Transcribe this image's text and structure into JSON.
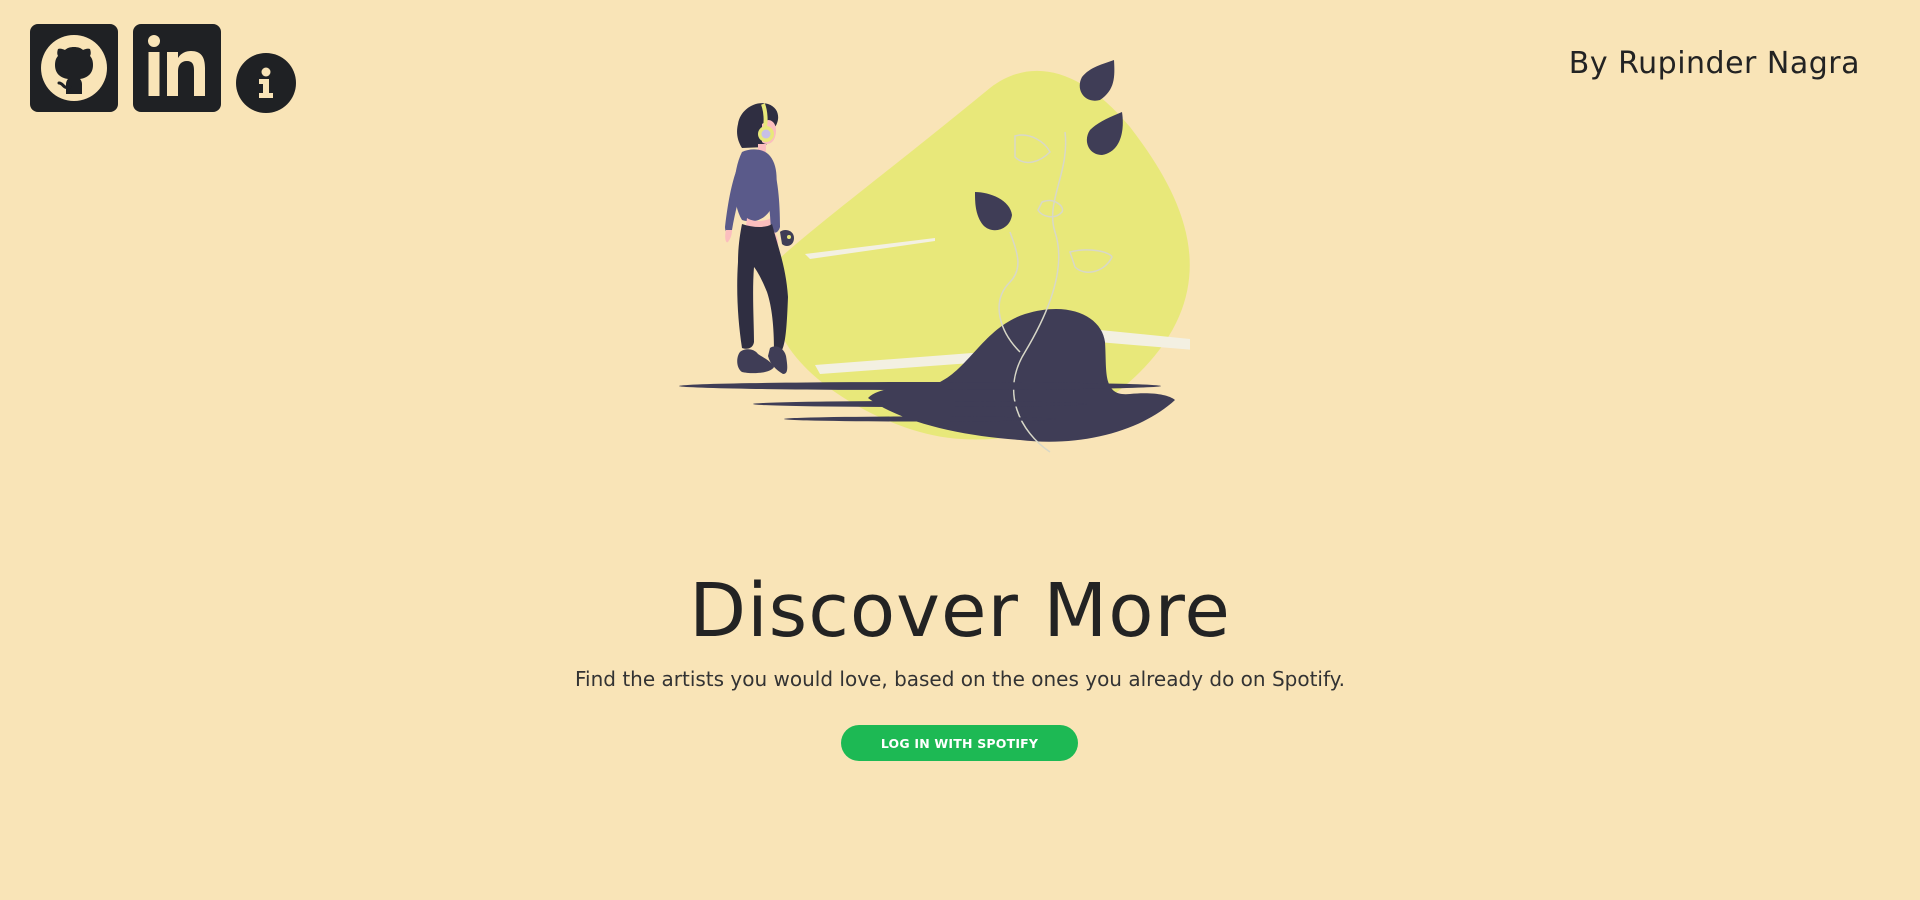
{
  "header": {
    "author_text": "By Rupinder Nagra",
    "social_links": [
      {
        "icon": "github-icon",
        "label": "GitHub"
      },
      {
        "icon": "linkedin-icon",
        "label": "LinkedIn"
      },
      {
        "icon": "info-icon",
        "label": "Info"
      }
    ]
  },
  "hero": {
    "title": "Discover More",
    "subtitle": "Find the artists you would love, based on the ones you already do on Spotify.",
    "login_button_label": "LOG IN WITH SPOTIFY"
  },
  "colors": {
    "background": "#f9e4b7",
    "text": "#232323",
    "icon_bg": "#1f2124",
    "spotify_green": "#1db954",
    "illustration_yellow": "#e8e87a",
    "illustration_dark": "#3f3d56",
    "illustration_purple": "#5a5a8a"
  }
}
